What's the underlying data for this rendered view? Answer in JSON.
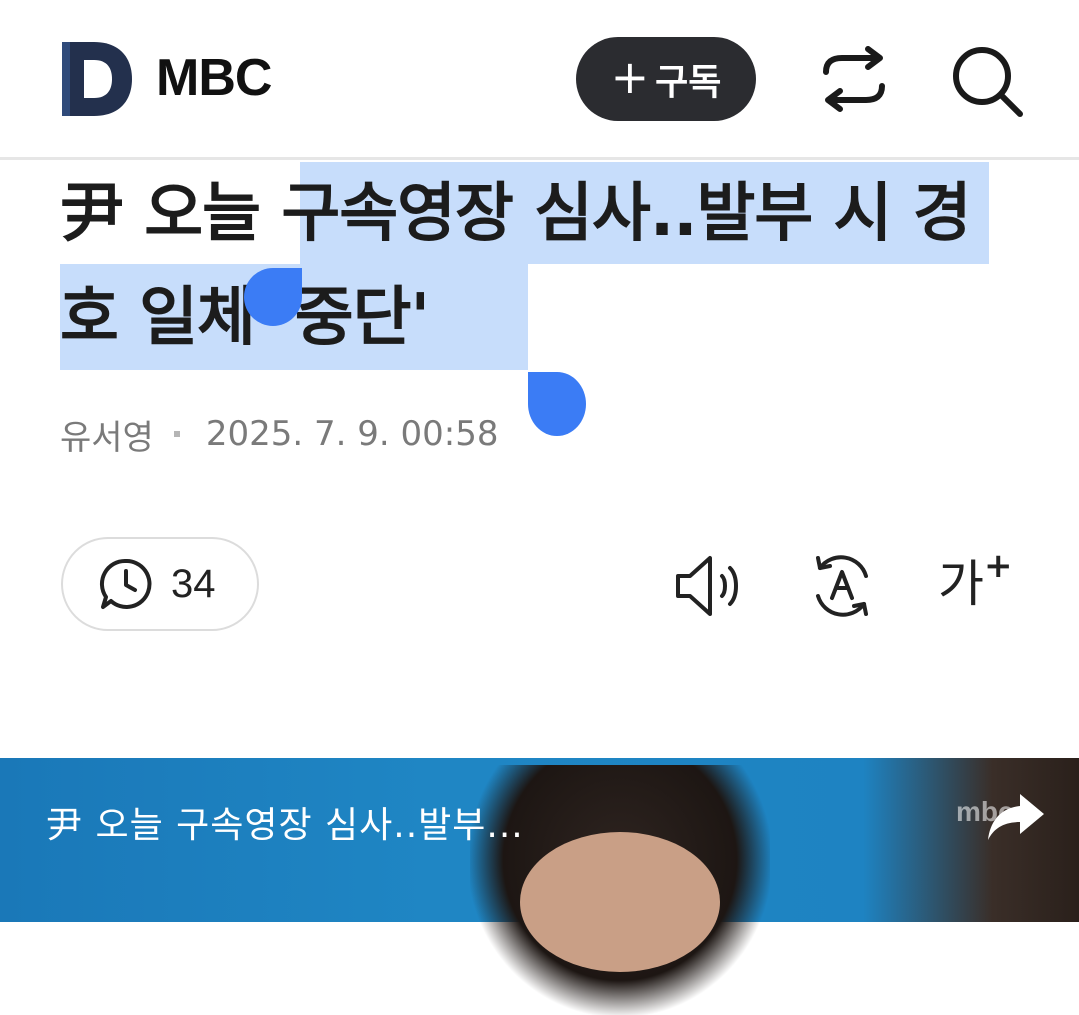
{
  "header": {
    "logo_letter": "D",
    "brand": "MBC",
    "subscribe_plus": "+",
    "subscribe_label": "구독",
    "share_icon": "share-icon",
    "search_icon": "search-icon"
  },
  "article": {
    "headline": "尹 오늘 구속영장 심사..발부 시 경호 일체 '중단'",
    "selected_text": "구속영장 심사..발부 시 경호 일체 '중단'",
    "author": "유서영",
    "datetime": "2025. 7. 9. 00:58",
    "selection_color": "#c7ddfb",
    "handle_color": "#3b7cf5"
  },
  "toolbar": {
    "comment_count": "34",
    "comment_icon": "comment-clock-icon",
    "listen_icon": "speaker-icon",
    "translate_icon": "translate-icon",
    "font_size_label": "가",
    "font_size_sup": "+"
  },
  "video": {
    "title": "尹 오늘 구속영장 심사..발부...",
    "watermark": "mbc",
    "share_icon": "share-arrow-icon"
  }
}
